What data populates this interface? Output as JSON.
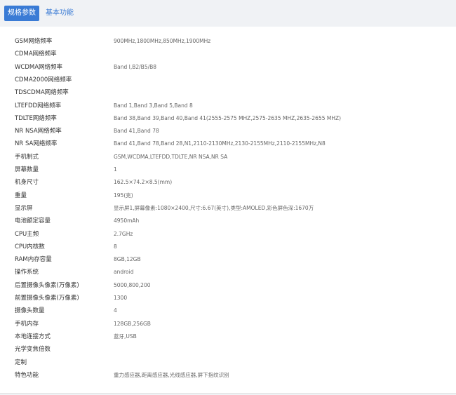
{
  "tabs": [
    {
      "label": "规格参数",
      "active": true
    },
    {
      "label": "基本功能",
      "active": false
    }
  ],
  "specs": [
    {
      "label": "GSM网络频率",
      "value": "900MHz,1800MHz,850MHz,1900MHz"
    },
    {
      "label": "CDMA网络频率",
      "value": ""
    },
    {
      "label": "WCDMA网络频率",
      "value": "Band Ⅰ,B2/B5/B8"
    },
    {
      "label": "CDMA2000网络频率",
      "value": ""
    },
    {
      "label": "TDSCDMA网络频率",
      "value": ""
    },
    {
      "label": "LTEFDD网络频率",
      "value": "Band 1,Band 3,Band 5,Band 8"
    },
    {
      "label": "TDLTE网络频率",
      "value": "Band 38,Band 39,Band 40,Band 41(2555-2575 MHZ,2575-2635 MHZ,2635-2655 MHZ)"
    },
    {
      "label": "NR NSA网络频率",
      "value": "Band 41,Band 78"
    },
    {
      "label": "NR SA网络频率",
      "value": "Band 41,Band 78,Band 28,N1,2110-2130MHz,2130-2155MHz,2110-2155MHz,N8"
    },
    {
      "label": "手机制式",
      "value": "GSM,WCDMA,LTEFDD,TDLTE,NR NSA,NR SA"
    },
    {
      "label": "屏幕数量",
      "value": "1"
    },
    {
      "label": "机身尺寸",
      "value": "162.5×74.2×8.5(mm)"
    },
    {
      "label": "重量",
      "value": "195(克)"
    },
    {
      "label": "显示屏",
      "value": "显示屏1,屏幕像素:1080×2400,尺寸:6.67(英寸),类型:AMOLED,彩色屏色深:1670万"
    },
    {
      "label": "电池额定容量",
      "value": "4950mAh"
    },
    {
      "label": "CPU主频",
      "value": "2.7GHz"
    },
    {
      "label": "CPU内核数",
      "value": "8"
    },
    {
      "label": "RAM内存容量",
      "value": "8GB,12GB"
    },
    {
      "label": "操作系统",
      "value": "android"
    },
    {
      "label": "后置摄像头像素(万像素)",
      "value": "5000,800,200"
    },
    {
      "label": "前置摄像头像素(万像素)",
      "value": "1300"
    },
    {
      "label": "摄像头数量",
      "value": "4"
    },
    {
      "label": "手机内存",
      "value": "128GB,256GB"
    },
    {
      "label": "本地连接方式",
      "value": "蓝牙,USB"
    },
    {
      "label": "光学变焦倍数",
      "value": ""
    },
    {
      "label": "定制",
      "value": ""
    },
    {
      "label": "特色功能",
      "value": "重力感应器,距离感应器,光线感应器,屏下指纹识别"
    }
  ]
}
